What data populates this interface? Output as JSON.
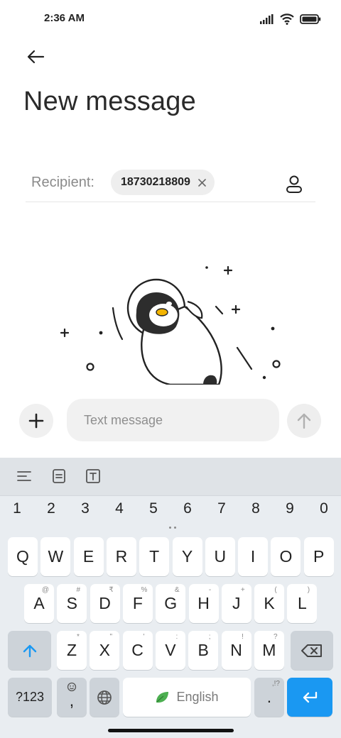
{
  "status_bar": {
    "time": "2:36 AM",
    "icons": [
      "signal-icon",
      "wifi-icon",
      "battery-icon"
    ]
  },
  "header": {
    "back_icon": "arrow-left-icon",
    "title": "New message"
  },
  "recipient": {
    "label": "Recipient:",
    "chip_value": "18730218809",
    "chip_remove_icon": "close-icon",
    "contact_icon": "contact-icon"
  },
  "illustration": {
    "name": "penguin-astronaut-illustration"
  },
  "compose": {
    "attach_icon": "plus-icon",
    "placeholder": "Text message",
    "send_icon": "arrow-up-icon"
  },
  "keyboard": {
    "toolbar_icons": [
      "menu-lines-icon",
      "clipboard-icon",
      "text-format-icon"
    ],
    "number_row": [
      "1",
      "2",
      "3",
      "4",
      "5",
      "6",
      "7",
      "8",
      "9",
      "0"
    ],
    "row1": [
      {
        "main": "Q",
        "sub": ""
      },
      {
        "main": "W",
        "sub": ""
      },
      {
        "main": "E",
        "sub": ""
      },
      {
        "main": "R",
        "sub": ""
      },
      {
        "main": "T",
        "sub": ""
      },
      {
        "main": "Y",
        "sub": ""
      },
      {
        "main": "U",
        "sub": ""
      },
      {
        "main": "I",
        "sub": ""
      },
      {
        "main": "O",
        "sub": ""
      },
      {
        "main": "P",
        "sub": ""
      }
    ],
    "row2": [
      {
        "main": "A",
        "sub": "@"
      },
      {
        "main": "S",
        "sub": "#"
      },
      {
        "main": "D",
        "sub": "₹"
      },
      {
        "main": "F",
        "sub": "%"
      },
      {
        "main": "G",
        "sub": "&"
      },
      {
        "main": "H",
        "sub": "-"
      },
      {
        "main": "J",
        "sub": "+"
      },
      {
        "main": "K",
        "sub": "("
      },
      {
        "main": "L",
        "sub": ")"
      }
    ],
    "row3": [
      {
        "main": "Z",
        "sub": "*"
      },
      {
        "main": "X",
        "sub": "\""
      },
      {
        "main": "C",
        "sub": "'"
      },
      {
        "main": "V",
        "sub": ":"
      },
      {
        "main": "B",
        "sub": ";"
      },
      {
        "main": "N",
        "sub": "!"
      },
      {
        "main": "M",
        "sub": "?"
      }
    ],
    "shift_icon": "shift-arrow-icon",
    "backspace_icon": "backspace-icon",
    "symbols_label": "?123",
    "emoji_comma_label": ",",
    "emoji_icon": "emoji-icon",
    "globe_icon": "globe-icon",
    "space_label": "English",
    "space_icon": "leaf-icon",
    "period_label": ".",
    "period_sub": ",!?",
    "enter_icon": "enter-icon"
  },
  "colors": {
    "accent": "#1a98f2",
    "keyboard_bg": "#e9edf1",
    "leaf": "#4caf50"
  }
}
